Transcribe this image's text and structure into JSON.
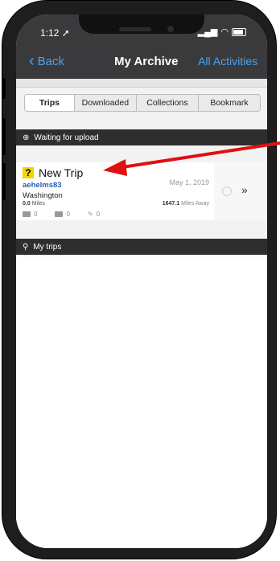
{
  "status_bar": {
    "time": "1:12"
  },
  "nav": {
    "back_label": "Back",
    "title": "My Archive",
    "right_label": "All Activities"
  },
  "tabs": [
    {
      "label": "Trips",
      "selected": true
    },
    {
      "label": "Downloaded",
      "selected": false
    },
    {
      "label": "Collections",
      "selected": false
    },
    {
      "label": "Bookmark",
      "selected": false
    }
  ],
  "sections": {
    "waiting": {
      "label": "Waiting for upload",
      "icon": "upload-icon"
    },
    "my_trips": {
      "label": "My trips",
      "icon": "trips-icon"
    }
  },
  "trip": {
    "title": "New Trip",
    "user": "aehelms83",
    "location": "Washington",
    "date": "May 1, 2019",
    "distance_value": "0.0",
    "distance_unit": "Miles",
    "away_value": "1647.1",
    "away_unit": "Miles Away",
    "photos": "0",
    "notes": "0",
    "waypoints": "0"
  },
  "colors": {
    "accent": "#4aa3f0",
    "header": "#3a3a3c",
    "annotation_arrow": "#e01010",
    "status_icon": "#f2d400"
  }
}
